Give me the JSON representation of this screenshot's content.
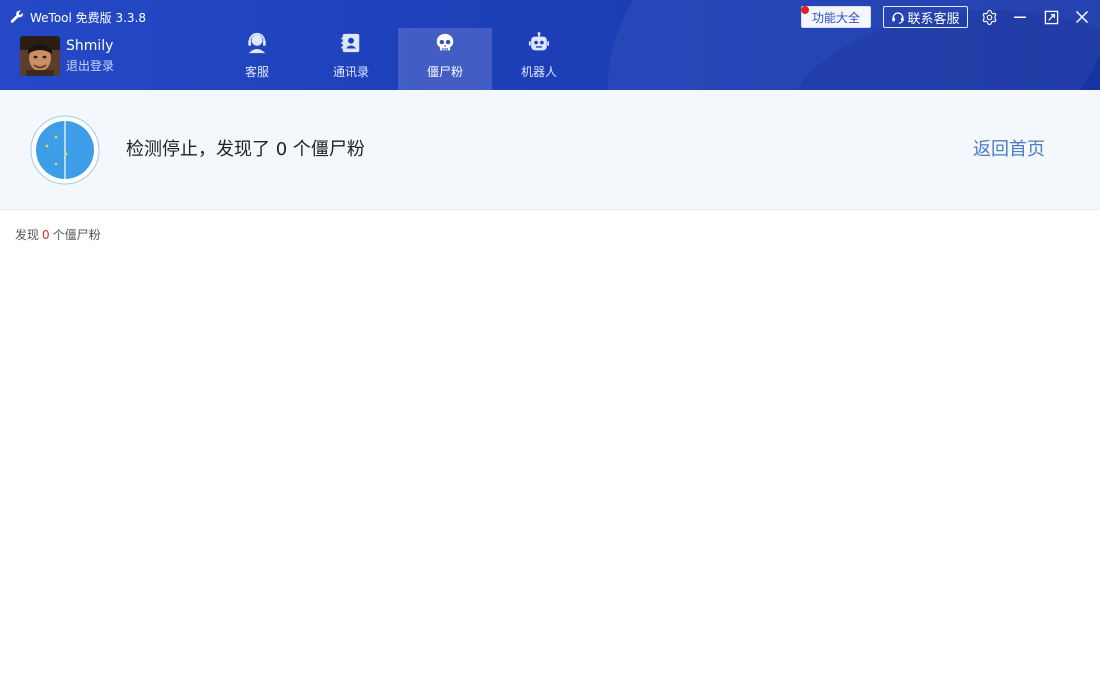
{
  "app": {
    "title": "WeTool 免费版 3.3.8",
    "title_icon": "wrench-icon"
  },
  "user": {
    "name": "Shmily",
    "logout_label": "退出登录"
  },
  "tabs": [
    {
      "label": "客服",
      "icon": "customer-service-icon",
      "active": false
    },
    {
      "label": "通讯录",
      "icon": "contacts-icon",
      "active": false
    },
    {
      "label": "僵尸粉",
      "icon": "skull-icon",
      "active": true
    },
    {
      "label": "机器人",
      "icon": "robot-icon",
      "active": false
    }
  ],
  "header_buttons": {
    "features_label": "功能大全",
    "contact_label": "联系客服",
    "contact_icon": "headset-icon"
  },
  "window_controls": [
    "settings-icon",
    "minimize-icon",
    "maximize-icon",
    "close-icon"
  ],
  "status": {
    "message": "检测停止，发现了 0 个僵尸粉",
    "back_label": "返回首页",
    "radar_icon": "radar-icon"
  },
  "result": {
    "prefix": "发现",
    "count": "0",
    "suffix": "个僵尸粉"
  },
  "colors": {
    "header_blue": "#1d3fb8",
    "accent_blue": "#4a7cc4",
    "radar_blue": "#3d9de8",
    "count_red": "#e02a2a",
    "badge_red": "#e0201c"
  }
}
